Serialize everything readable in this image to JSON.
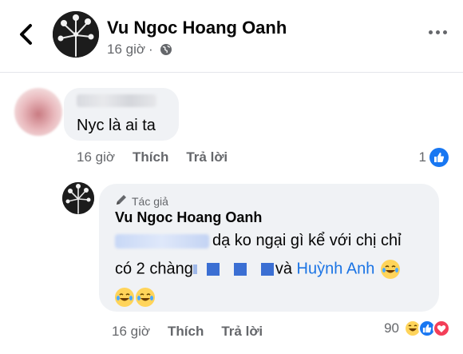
{
  "header": {
    "name": "Vu Ngoc Hoang Oanh",
    "time": "16 giờ",
    "separator": "·"
  },
  "comment1": {
    "text": "Nyc là ai ta",
    "time": "16 giờ",
    "like_label": "Thích",
    "reply_label": "Trả lời",
    "reaction_count": "1"
  },
  "comment2": {
    "author_badge": "Tác giả",
    "name": "Vu Ngoc Hoang Oanh",
    "line1": "dạ ko ngại gì kể với chị chỉ",
    "line2_prefix": "có 2 chàng",
    "line2_and": "và",
    "mention": "Huỳnh Anh",
    "time": "16 giờ",
    "like_label": "Thích",
    "reply_label": "Trả lời",
    "reaction_count": "90"
  },
  "colors": {
    "link": "#1b74e4",
    "like": "#1877f2",
    "love": "#f33e58",
    "haha": "#ffd45a"
  },
  "icons": [
    "back-arrow-icon",
    "globe-icon",
    "more-icon",
    "like-reaction-icon",
    "pencil-icon",
    "laughing-tears-emoji",
    "haha-reaction-icon",
    "love-reaction-icon"
  ]
}
